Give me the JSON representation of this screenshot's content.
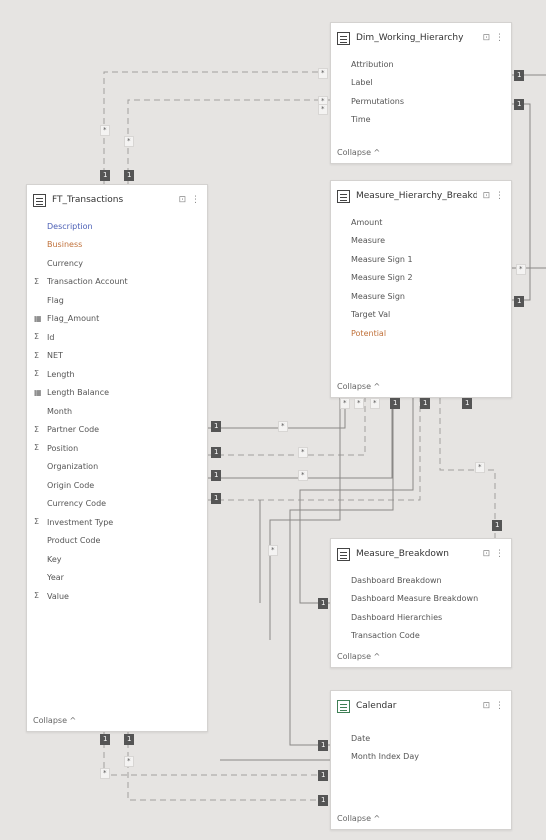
{
  "tables": {
    "top": {
      "title": "Dim_Working_Hierarchy",
      "menu": "⊡ ⋮",
      "fields": [
        {
          "label": "Attribution",
          "icon": "",
          "color": "gray"
        },
        {
          "label": "Label",
          "icon": "",
          "color": "gray"
        },
        {
          "label": "Permutations",
          "icon": "",
          "color": "gray"
        },
        {
          "label": "Time",
          "icon": "",
          "color": "gray"
        }
      ],
      "footer": "Collapse ^"
    },
    "second": {
      "title": "Measure_Hierarchy_Breakdown",
      "menu": "⊡ ⋮",
      "fields": [
        {
          "label": "Amount",
          "icon": "",
          "color": "gray"
        },
        {
          "label": "Measure",
          "icon": "",
          "color": "gray"
        },
        {
          "label": "Measure Sign 1",
          "icon": "",
          "color": "gray"
        },
        {
          "label": "Measure Sign 2",
          "icon": "",
          "color": "gray"
        },
        {
          "label": "Measure Sign",
          "icon": "",
          "color": "gray"
        },
        {
          "label": "Target Val",
          "icon": "",
          "color": "gray"
        },
        {
          "label": "Potential",
          "icon": "",
          "color": "orange"
        }
      ],
      "footer": "Collapse ^"
    },
    "left": {
      "title": "FT_Transactions",
      "menu": "⊡ ⋮",
      "fields": [
        {
          "label": "Description",
          "icon": "",
          "color": "blue"
        },
        {
          "label": "Business",
          "icon": "",
          "color": "orange"
        },
        {
          "label": "Currency",
          "icon": "",
          "color": "gray"
        },
        {
          "label": "Transaction Account",
          "icon": "Σ",
          "color": "gray"
        },
        {
          "label": "Flag",
          "icon": "",
          "color": "gray"
        },
        {
          "label": "Flag_Amount",
          "icon": "▦",
          "color": "gray"
        },
        {
          "label": "Id",
          "icon": "Σ",
          "color": "gray"
        },
        {
          "label": "NET",
          "icon": "Σ",
          "color": "gray"
        },
        {
          "label": "Length",
          "icon": "Σ",
          "color": "gray"
        },
        {
          "label": "Length Balance",
          "icon": "▦",
          "color": "gray"
        },
        {
          "label": "Month",
          "icon": "",
          "color": "gray"
        },
        {
          "label": "Partner Code",
          "icon": "Σ",
          "color": "gray"
        },
        {
          "label": "Position",
          "icon": "Σ",
          "color": "gray"
        },
        {
          "label": "Organization",
          "icon": "",
          "color": "gray"
        },
        {
          "label": "Origin Code",
          "icon": "",
          "color": "gray"
        },
        {
          "label": "Currency Code",
          "icon": "",
          "color": "gray"
        },
        {
          "label": "Investment Type",
          "icon": "Σ",
          "color": "gray"
        },
        {
          "label": "Product Code",
          "icon": "",
          "color": "gray"
        },
        {
          "label": "Key",
          "icon": "",
          "color": "gray"
        },
        {
          "label": "Year",
          "icon": "",
          "color": "gray"
        },
        {
          "label": "Value",
          "icon": "Σ",
          "color": "gray"
        }
      ],
      "footer": "Collapse ^"
    },
    "third": {
      "title": "Measure_Breakdown",
      "menu": "⊡ ⋮",
      "fields": [
        {
          "label": "Dashboard Breakdown",
          "icon": "",
          "color": "gray"
        },
        {
          "label": "Dashboard Measure Breakdown",
          "icon": "",
          "color": "gray"
        },
        {
          "label": "Dashboard Hierarchies",
          "icon": "",
          "color": "gray"
        },
        {
          "label": "Transaction Code",
          "icon": "",
          "color": "gray"
        }
      ],
      "footer": "Collapse ^"
    },
    "bottom": {
      "title": "Calendar",
      "menu": "⊡ ⋮",
      "fields": [
        {
          "label": "Date",
          "icon": "",
          "color": "gray"
        },
        {
          "label": "Month Index Day",
          "icon": "",
          "color": "gray"
        }
      ],
      "footer": "Collapse ^"
    }
  },
  "markers": {
    "one": "1",
    "many": "*"
  },
  "colors": {
    "canvas": "#e6e4e2",
    "line": "#8a8886",
    "dashed": "#a19f9d"
  }
}
